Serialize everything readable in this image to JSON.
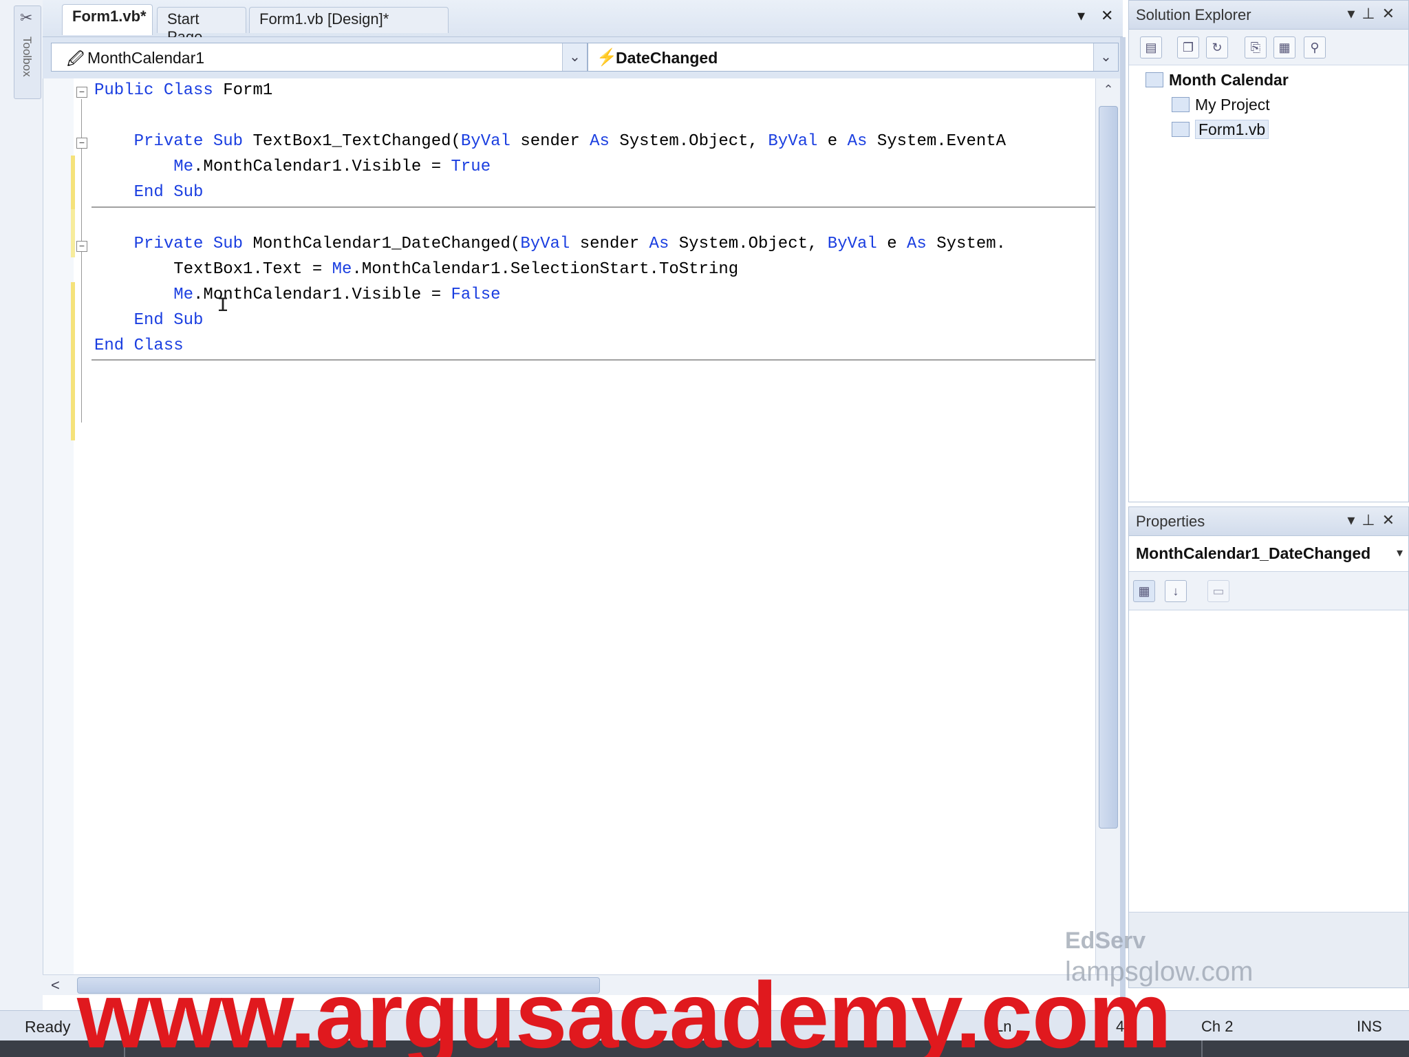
{
  "toolbox": {
    "label": "Toolbox"
  },
  "tabs": [
    {
      "label": "Form1.vb*",
      "active": true
    },
    {
      "label": "Start Page",
      "active": false
    },
    {
      "label": "Form1.vb [Design]*",
      "active": false
    }
  ],
  "tabbar_controls": {
    "dropdown_icon": "chevron-down-icon",
    "close_icon": "close-icon"
  },
  "object_combo": {
    "value": "MonthCalendar1",
    "icon": "control-icon"
  },
  "event_combo": {
    "value": "DateChanged",
    "icon": "lightning-icon"
  },
  "code": {
    "lines": [
      "Public Class Form1",
      "",
      "    Private Sub TextBox1_TextChanged(ByVal sender As System.Object, ByVal e As System.EventA",
      "        Me.MonthCalendar1.Visible = True",
      "    End Sub",
      "",
      "    Private Sub MonthCalendar1_DateChanged(ByVal sender As System.Object, ByVal e As System.",
      "        TextBox1.Text = Me.MonthCalendar1.SelectionStart.ToString",
      "        Me.MonthCalendar1.Visible = False",
      "    End Sub",
      "End Class"
    ]
  },
  "solution_explorer": {
    "title": "Solution Explorer",
    "tree": {
      "root": "Month Calendar",
      "children": [
        "My Project",
        "Form1.vb"
      ]
    }
  },
  "properties": {
    "title": "Properties",
    "selected_object": "MonthCalendar1_DateChanged",
    "toolbar_icons": [
      "categorized-icon",
      "alphabetical-icon",
      "property-pages-icon"
    ]
  },
  "status": {
    "ready": "Ready",
    "line": "Ln",
    "column_value": "42",
    "ch": "Ch 2",
    "mode": "INS"
  },
  "watermarks": {
    "argus": "www.argusacademy.com",
    "edserv": "EdServ",
    "lamp": "lampsglow.com"
  }
}
